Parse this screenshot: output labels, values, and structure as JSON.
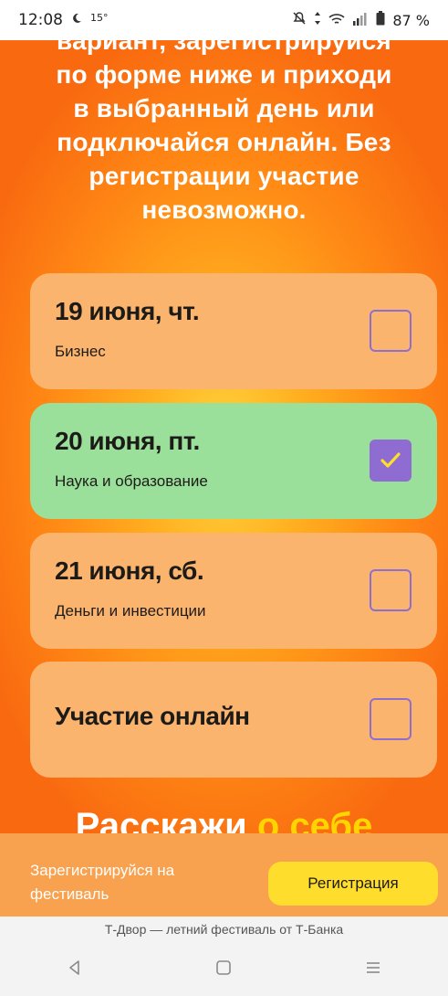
{
  "status_bar": {
    "time": "12:08",
    "temperature": "15°",
    "battery": "87 %",
    "icons": [
      "weather-icon",
      "mute-icon",
      "data-arrows-icon",
      "wifi-icon",
      "signal-icon",
      "battery-icon"
    ]
  },
  "intro": {
    "lines": [
      "вариант, зарегистрируйся",
      "по форме ниже и приходи",
      "в выбранный день или",
      "подключайся онлайн. Без",
      "регистрации участие",
      "невозможно."
    ]
  },
  "options": [
    {
      "date": "19 июня, чт.",
      "topic": "Бизнес",
      "checked": false
    },
    {
      "date": "20 июня, пт.",
      "topic": "Наука и образование",
      "checked": true
    },
    {
      "date": "21 июня, сб.",
      "topic": "Деньги и инвестиции",
      "checked": false
    },
    {
      "date": "Участие онлайн",
      "checked": false
    }
  ],
  "section_title": {
    "main": "Расскажи",
    "accent": "о себе"
  },
  "registration": {
    "text": "Зарегистрируйся на фестиваль",
    "button_label": "Регистрация"
  },
  "footer": {
    "text": "Т-Двор — летний фестиваль от Т-Банка"
  },
  "colors": {
    "accent_yellow": "#ffdd2d",
    "selected_card": "#9be09a",
    "card": "#fbb46e",
    "checkbox_purple": "#8f6cd2",
    "background_orange": "#ff8c14"
  }
}
